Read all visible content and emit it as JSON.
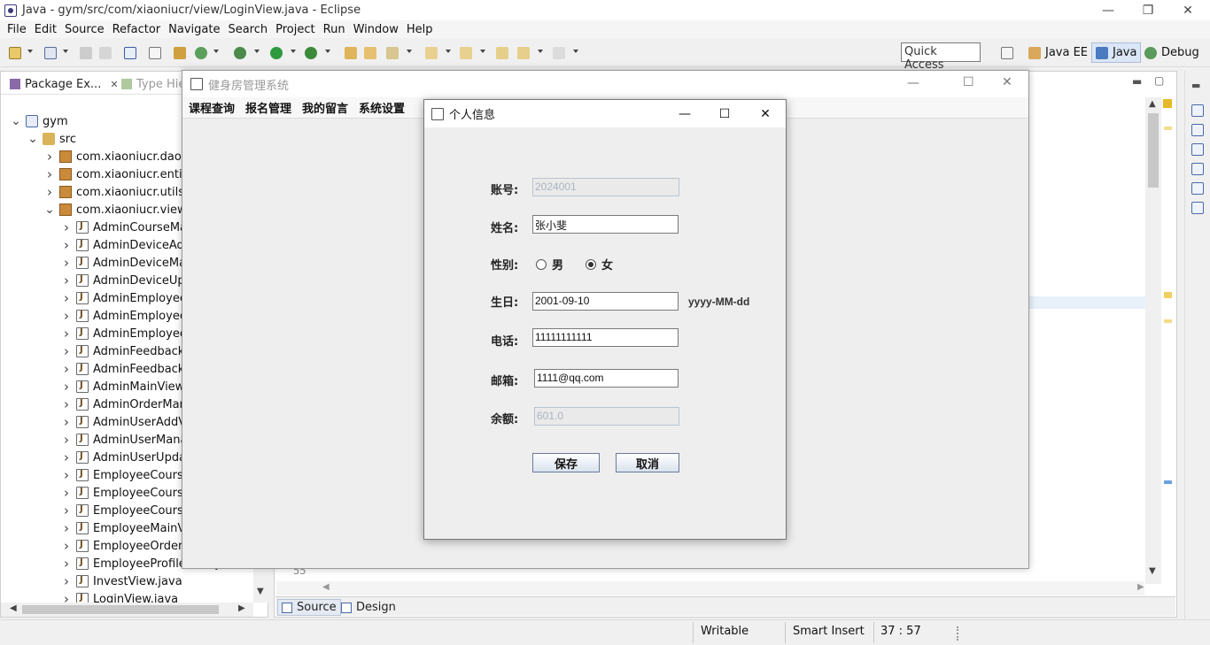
{
  "eclipse": {
    "title": "Java - gym/src/com/xiaoniucr/view/LoginView.java - Eclipse",
    "menu": [
      "File",
      "Edit",
      "Source",
      "Refactor",
      "Navigate",
      "Search",
      "Project",
      "Run",
      "Window",
      "Help"
    ],
    "quick_access": "Quick Access",
    "perspectives": [
      "Java EE",
      "Java",
      "Debug"
    ]
  },
  "package_explorer": {
    "tab_label": "Package Ex...",
    "tab_close": "✕",
    "type_tab_label": "Type Hie",
    "tree": [
      {
        "label": "gym",
        "level": 0,
        "kind": "proj",
        "twisty": "v"
      },
      {
        "label": "src",
        "level": 1,
        "kind": "folder",
        "twisty": "v"
      },
      {
        "label": "com.xiaoniucr.dao",
        "level": 2,
        "kind": "pkg",
        "twisty": ">"
      },
      {
        "label": "com.xiaoniucr.entity",
        "level": 2,
        "kind": "pkg",
        "twisty": ">"
      },
      {
        "label": "com.xiaoniucr.utils",
        "level": 2,
        "kind": "pkg",
        "twisty": ">"
      },
      {
        "label": "com.xiaoniucr.view",
        "level": 2,
        "kind": "pkg",
        "twisty": "v"
      },
      {
        "label": "AdminCourseMan",
        "level": 3,
        "kind": "java",
        "twisty": ">"
      },
      {
        "label": "AdminDeviceAdd",
        "level": 3,
        "kind": "java",
        "twisty": ">"
      },
      {
        "label": "AdminDeviceMan",
        "level": 3,
        "kind": "java",
        "twisty": ">"
      },
      {
        "label": "AdminDeviceUpd",
        "level": 3,
        "kind": "java",
        "twisty": ">"
      },
      {
        "label": "AdminEmployeeA",
        "level": 3,
        "kind": "java",
        "twisty": ">"
      },
      {
        "label": "AdminEmployeeM",
        "level": 3,
        "kind": "java",
        "twisty": ">"
      },
      {
        "label": "AdminEmployeeU",
        "level": 3,
        "kind": "java",
        "twisty": ">"
      },
      {
        "label": "AdminFeedbackM",
        "level": 3,
        "kind": "java",
        "twisty": ">"
      },
      {
        "label": "AdminFeedbackR",
        "level": 3,
        "kind": "java",
        "twisty": ">"
      },
      {
        "label": "AdminMainView.j",
        "level": 3,
        "kind": "java",
        "twisty": ">"
      },
      {
        "label": "AdminOrderMana",
        "level": 3,
        "kind": "java",
        "twisty": ">"
      },
      {
        "label": "AdminUserAddVi",
        "level": 3,
        "kind": "java",
        "twisty": ">"
      },
      {
        "label": "AdminUserManag",
        "level": 3,
        "kind": "java",
        "twisty": ">"
      },
      {
        "label": "AdminUserUpdat",
        "level": 3,
        "kind": "java",
        "twisty": ">"
      },
      {
        "label": "EmployeeCourse",
        "level": 3,
        "kind": "java",
        "twisty": ">"
      },
      {
        "label": "EmployeeCourse",
        "level": 3,
        "kind": "java",
        "twisty": ">"
      },
      {
        "label": "EmployeeCourse",
        "level": 3,
        "kind": "java",
        "twisty": ">"
      },
      {
        "label": "EmployeeMainVi",
        "level": 3,
        "kind": "java",
        "twisty": ">"
      },
      {
        "label": "EmployeeOrderM",
        "level": 3,
        "kind": "java",
        "twisty": ">"
      },
      {
        "label": "EmployeeProfileView.java",
        "level": 3,
        "kind": "java",
        "twisty": ">"
      },
      {
        "label": "InvestView.java",
        "level": 3,
        "kind": "java",
        "twisty": ">"
      },
      {
        "label": "LoginView.java",
        "level": 3,
        "kind": "java",
        "twisty": ">"
      }
    ]
  },
  "editor": {
    "line_number": "55",
    "bottom_tabs": [
      "Source",
      "Design"
    ]
  },
  "status": {
    "writable": "Writable",
    "insert_mode": "Smart Insert",
    "position": "37 : 57"
  },
  "gym_app": {
    "title": "健身房管理系统",
    "menu": [
      "课程查询",
      "报名管理",
      "我的留言",
      "系统设置"
    ]
  },
  "dialog": {
    "title": "个人信息",
    "account_label": "账号:",
    "account_value": "2024001",
    "name_label": "姓名:",
    "name_value": "张小斐",
    "gender_label": "性别:",
    "gender_male": "男",
    "gender_female": "女",
    "gender_selected": "女",
    "birthday_label": "生日:",
    "birthday_value": "2001-09-10",
    "birthday_hint": "yyyy-MM-dd",
    "phone_label": "电话:",
    "phone_value": "11111111111",
    "email_label": "邮箱:",
    "email_value": "1111@qq.com",
    "balance_label": "余额:",
    "balance_value": "601.0",
    "save_button": "保存",
    "cancel_button": "取消"
  },
  "colors": {
    "dialog_bg": "#eeeeee",
    "disabled_text": "#aab4c2",
    "button_border": "#6a7a9a"
  }
}
